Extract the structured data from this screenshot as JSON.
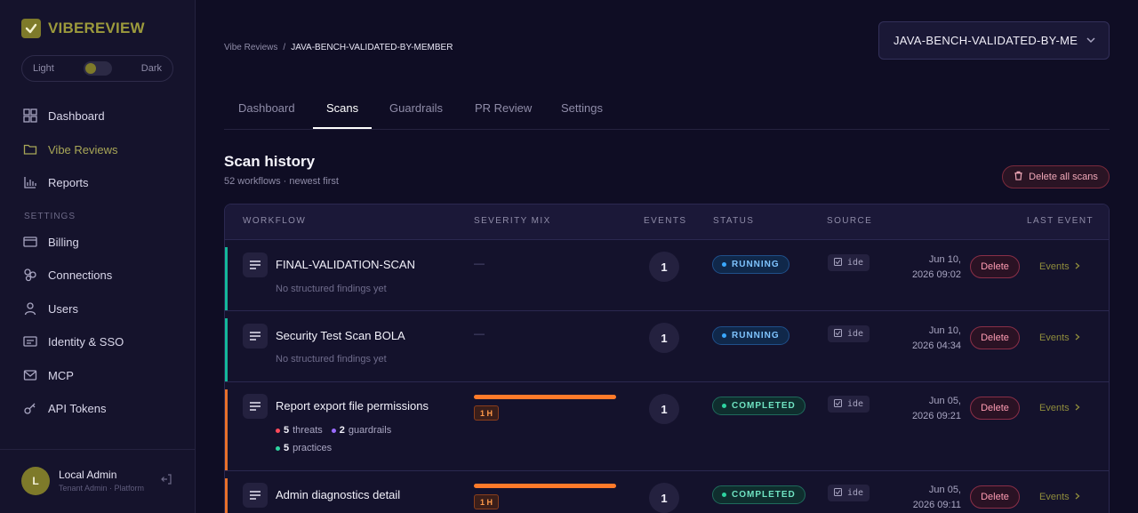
{
  "app": {
    "brand": "VIBEREVIEW"
  },
  "theme": {
    "light_label": "Light",
    "dark_label": "Dark"
  },
  "sidebar": {
    "items": [
      {
        "label": "Dashboard",
        "icon": "grid-icon"
      },
      {
        "label": "Vibe Reviews",
        "icon": "folder-icon",
        "active": true
      },
      {
        "label": "Reports",
        "icon": "bar-chart-icon"
      }
    ],
    "settings_label": "SETTINGS",
    "settings_items": [
      {
        "label": "Billing",
        "icon": "credit-card-icon"
      },
      {
        "label": "Connections",
        "icon": "connections-icon"
      },
      {
        "label": "Users",
        "icon": "user-icon"
      },
      {
        "label": "Identity & SSO",
        "icon": "id-card-icon"
      },
      {
        "label": "MCP",
        "icon": "mail-icon"
      },
      {
        "label": "API Tokens",
        "icon": "key-icon"
      }
    ]
  },
  "user": {
    "initial": "L",
    "name": "Local Admin",
    "role": "Tenant Admin · Platform"
  },
  "breadcrumb": {
    "parent": "Vibe Reviews",
    "separator": "/",
    "current": "JAVA-BENCH-VALIDATED-BY-MEMBER"
  },
  "workspace": {
    "selected": "JAVA-BENCH-VALIDATED-BY-MEMBER"
  },
  "tabs": [
    "Dashboard",
    "Scans",
    "Guardrails",
    "PR Review",
    "Settings"
  ],
  "active_tab": "Scans",
  "scan_history": {
    "title": "Scan history",
    "subtitle": "52 workflows · newest first",
    "delete_all_label": "Delete all scans",
    "columns": [
      "WORKFLOW",
      "SEVERITY MIX",
      "EVENTS",
      "STATUS",
      "SOURCE",
      "LAST EVENT"
    ],
    "rows": [
      {
        "name": "FINAL-VALIDATION-SCAN",
        "note": "No structured findings yet",
        "severity": "—",
        "events": "1",
        "status": "RUNNING",
        "source": "ide",
        "date_line1": "Jun 10,",
        "date_line2": "2026 09:02",
        "delete_label": "Delete",
        "events_label": "Events",
        "accent": "#14b89a"
      },
      {
        "name": "Security Test Scan BOLA",
        "note": "No structured findings yet",
        "severity": "—",
        "events": "1",
        "status": "RUNNING",
        "source": "ide",
        "date_line1": "Jun 10,",
        "date_line2": "2026 04:34",
        "delete_label": "Delete",
        "events_label": "Events",
        "accent": "#14b89a"
      },
      {
        "name": "Report export file permissions",
        "severity_tag": "1 H",
        "threats": "5",
        "threats_label": "threats",
        "guardrails": "2",
        "guardrails_label": "guardrails",
        "practices": "5",
        "practices_label": "practices",
        "events": "1",
        "status": "COMPLETED",
        "source": "ide",
        "date_line1": "Jun 05,",
        "date_line2": "2026 09:21",
        "delete_label": "Delete",
        "events_label": "Events",
        "accent": "#e8702a"
      },
      {
        "name": "Admin diagnostics detail",
        "severity_tag": "1 H",
        "events": "1",
        "status": "COMPLETED",
        "source": "ide",
        "date_line1": "Jun 05,",
        "date_line2": "2026 09:11",
        "delete_label": "Delete",
        "events_label": "Events",
        "accent": "#e8702a"
      }
    ]
  },
  "colors": {
    "accent": "#9c9a3c",
    "high": "#ff7a2a",
    "running": "#3aa8ff",
    "completed": "#2ed3a0",
    "danger": "#ff9cb2",
    "threat_dot": "#ff4a5a",
    "guardrail_dot": "#9a6bff",
    "practice_dot": "#2ed3a0"
  }
}
